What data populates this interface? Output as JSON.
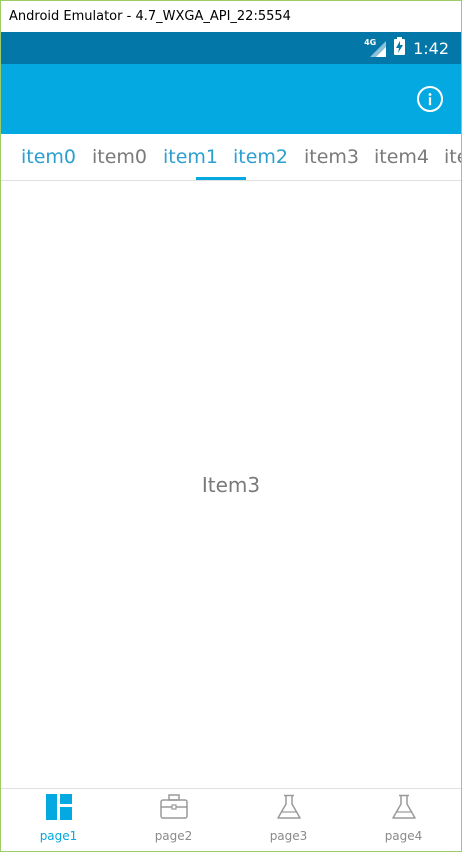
{
  "window": {
    "title": "Android Emulator - 4.7_WXGA_API_22:5554"
  },
  "status_bar": {
    "network": "4G",
    "time": "1:42"
  },
  "app_bar": {
    "action_icon": "info-icon"
  },
  "tabs": [
    {
      "label": "item0",
      "active": true
    },
    {
      "label": "item0",
      "active": false
    },
    {
      "label": "item1",
      "active": true
    },
    {
      "label": "item2",
      "active": true
    },
    {
      "label": "item3",
      "active": false
    },
    {
      "label": "item4",
      "active": false
    },
    {
      "label": "ite",
      "active": false
    }
  ],
  "content": {
    "label": "Item3"
  },
  "bottom_nav": [
    {
      "label": "page1",
      "icon": "dashboard-icon",
      "active": true
    },
    {
      "label": "page2",
      "icon": "briefcase-icon",
      "active": false
    },
    {
      "label": "page3",
      "icon": "flask-icon",
      "active": false
    },
    {
      "label": "page4",
      "icon": "flask-icon",
      "active": false
    }
  ],
  "colors": {
    "status_bar": "#0277a8",
    "app_bar": "#03a9e0",
    "active_tab_text": "#2a9fd0",
    "inactive_text": "#7a7a7a",
    "active_nav": "#03a9e0"
  }
}
